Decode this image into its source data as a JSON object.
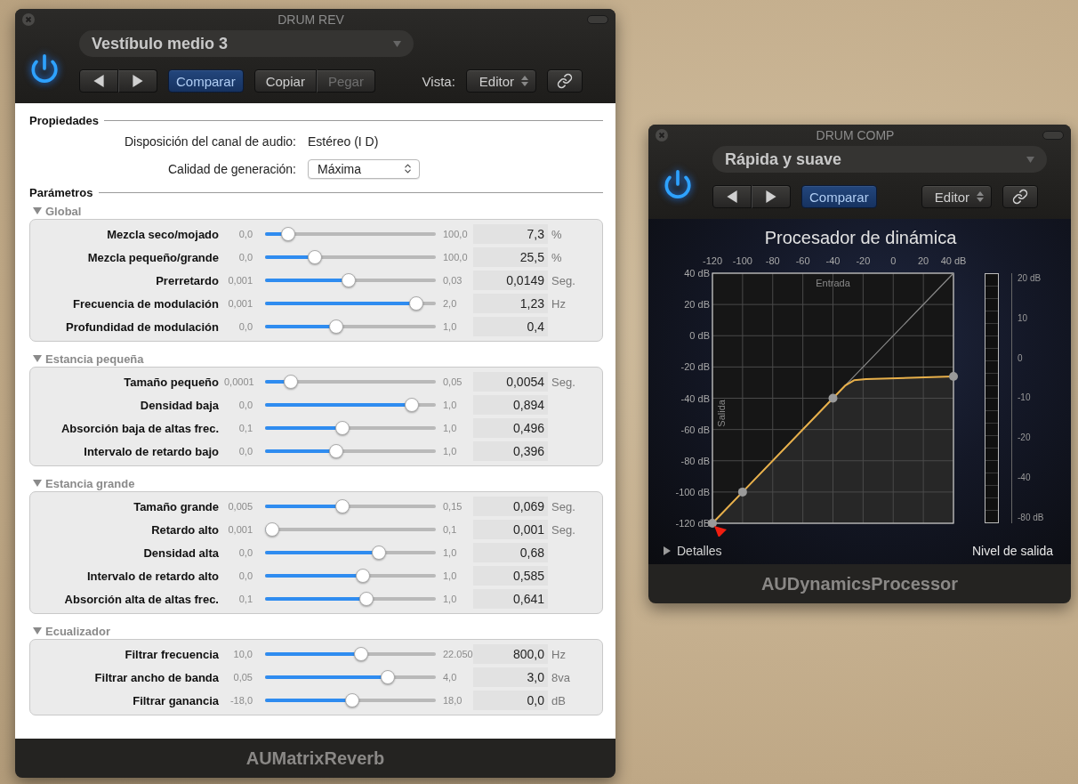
{
  "reverb_window": {
    "title": "DRUM REV",
    "power_on": true,
    "preset": "Vestíbulo medio 3",
    "toolbar": [
      {
        "kind": "nav"
      },
      {
        "kind": "toggle",
        "label": "Comparar",
        "on": true
      },
      {
        "kind": "pair",
        "buttons": [
          {
            "label": "Copiar",
            "disabled": false
          },
          {
            "label": "Pegar",
            "disabled": true
          }
        ]
      },
      {
        "kind": "label",
        "label": "Vista:"
      },
      {
        "kind": "popup",
        "label": "Editor"
      },
      {
        "kind": "link"
      }
    ],
    "properties": {
      "heading": "Propiedades",
      "rows": [
        {
          "kind": "text",
          "label": "Disposición del canal de audio:",
          "value": "Estéreo (I D)"
        },
        {
          "kind": "select",
          "label": "Calidad de generación:",
          "value": "Máxima"
        }
      ]
    },
    "parameters": {
      "heading": "Parámetros",
      "groups": [
        {
          "title": "Global",
          "expanded": true,
          "rows": [
            {
              "label": "Mezcla seco/mojado",
              "min": "0,0",
              "max": "100,0",
              "value": "7,3",
              "unit": "%",
              "level": 0.1
            },
            {
              "label": "Mezcla pequeño/grande",
              "min": "0,0",
              "max": "100,0",
              "value": "25,5",
              "unit": "%",
              "level": 0.27
            },
            {
              "label": "Prerretardo",
              "min": "0,001",
              "max": "0,03",
              "value": "0,0149",
              "unit": "Seg.",
              "level": 0.49
            },
            {
              "label": "Frecuencia de modulación",
              "min": "0,001",
              "max": "2,0",
              "value": "1,23",
              "unit": "Hz",
              "level": 0.92
            },
            {
              "label": "Profundidad de modulación",
              "min": "0,0",
              "max": "1,0",
              "value": "0,4",
              "level": 0.41
            }
          ]
        },
        {
          "title": "Estancia pequeña",
          "expanded": true,
          "rows": [
            {
              "label": "Tamaño pequeño",
              "min": "0,0001",
              "max": "0,05",
              "value": "0,0054",
              "unit": "Seg.",
              "level": 0.12
            },
            {
              "label": "Densidad baja",
              "min": "0,0",
              "max": "1,0",
              "value": "0,894",
              "level": 0.89
            },
            {
              "label": "Absorción baja de altas frec.",
              "min": "0,1",
              "max": "1,0",
              "value": "0,496",
              "level": 0.45
            },
            {
              "label": "Intervalo de retardo bajo",
              "min": "0,0",
              "max": "1,0",
              "value": "0,396",
              "level": 0.41
            }
          ]
        },
        {
          "title": "Estancia grande",
          "expanded": true,
          "rows": [
            {
              "label": "Tamaño grande",
              "min": "0,005",
              "max": "0,15",
              "value": "0,069",
              "unit": "Seg.",
              "level": 0.45
            },
            {
              "label": "Retardo alto",
              "min": "0,001",
              "max": "0,1",
              "value": "0,001",
              "unit": "Seg.",
              "level": 0
            },
            {
              "label": "Densidad alta",
              "min": "0,0",
              "max": "1,0",
              "value": "0,68",
              "level": 0.68
            },
            {
              "label": "Intervalo de retardo alto",
              "min": "0,0",
              "max": "1,0",
              "value": "0,585",
              "level": 0.58
            },
            {
              "label": "Absorción alta de altas frec.",
              "min": "0,1",
              "max": "1,0",
              "value": "0,641",
              "level": 0.6
            }
          ]
        },
        {
          "title": "Ecualizador",
          "expanded": true,
          "rows": [
            {
              "label": "Filtrar frecuencia",
              "min": "10,0",
              "max": "22.050",
              "value": "800,0",
              "unit": "Hz",
              "level": 0.57
            },
            {
              "label": "Filtrar ancho de banda",
              "min": "0,05",
              "max": "4,0",
              "value": "3,0",
              "unit": "8va",
              "level": 0.74
            },
            {
              "label": "Filtrar ganancia",
              "min": "-18,0",
              "max": "18,0",
              "value": "0,0",
              "unit": "dB",
              "level": 0.51
            }
          ]
        }
      ]
    },
    "footer": "AUMatrixReverb"
  },
  "comp_window": {
    "title": "DRUM COMP",
    "power_on": true,
    "preset": "Rápida y suave",
    "toolbar": [
      {
        "kind": "nav"
      },
      {
        "kind": "toggle",
        "label": "Comparar",
        "on": true
      },
      {
        "kind": "popup",
        "label": "Editor"
      },
      {
        "kind": "link"
      }
    ],
    "graph": {
      "title": "Procesador de dinámica",
      "chart_data": {
        "type": "line",
        "xlabel": "Entrada",
        "ylabel": "Salida",
        "grid": true,
        "x": [
          -120,
          -100,
          -40,
          -32,
          -26,
          -18,
          40
        ],
        "series": [
          {
            "color": "#e8b04a",
            "values": [
              -120,
              -100,
              -40,
              -32,
              -28.5,
              -27.8,
              -26
            ]
          },
          {
            "color": "#8c8c8c",
            "values": [
              -120,
              -100,
              -40,
              -32,
              -26,
              -18,
              40
            ]
          }
        ],
        "xlim": [
          -120,
          40
        ],
        "ylim": [
          -120,
          40
        ],
        "xticks": [
          -120,
          -100,
          -80,
          -60,
          -40,
          -20,
          0,
          20,
          {
            "value": 40,
            "label": "40 dB"
          }
        ],
        "yticks": [
          {
            "value": 40,
            "label": "40 dB"
          },
          {
            "value": 20,
            "label": "20 dB"
          },
          {
            "value": 0,
            "label": "0 dB"
          },
          {
            "value": -20,
            "label": "-20 dB"
          },
          {
            "value": -40,
            "label": "-40 dB"
          },
          {
            "value": -60,
            "label": "-60 dB"
          },
          {
            "value": -80,
            "label": "-80 dB"
          },
          {
            "value": -100,
            "label": "-100 dB"
          },
          {
            "value": -120,
            "label": "-120 dB"
          }
        ]
      },
      "meter": {
        "scale": [
          "20 dB",
          "10",
          "0",
          "-10",
          "-20",
          "-40",
          "-80 dB"
        ]
      },
      "details": {
        "label": "Detalles",
        "expanded": false
      },
      "meter_label": "Nivel de salida"
    },
    "footer": "AUDynamicsProcessor"
  }
}
